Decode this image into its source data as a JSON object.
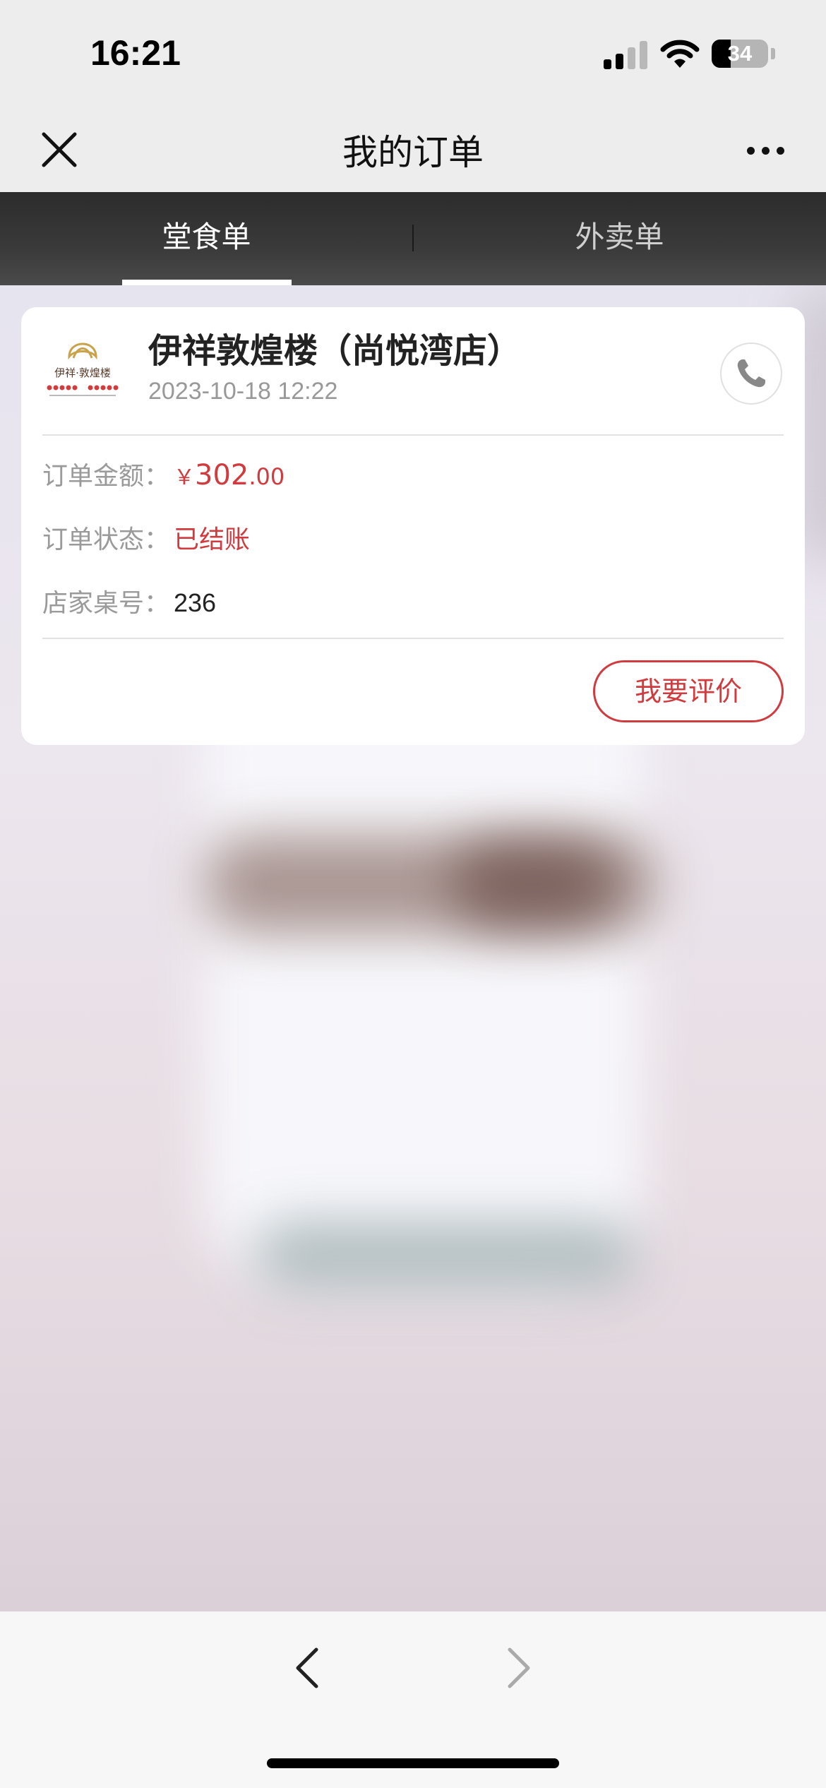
{
  "status_bar": {
    "time": "16:21",
    "battery_percent": "34",
    "battery_level": 0.34,
    "signal_bars_active": 2
  },
  "navbar": {
    "title": "我的订单",
    "close_icon": "close-icon",
    "more_icon": "more-icon"
  },
  "tabs": [
    {
      "label": "堂食单",
      "active": true
    },
    {
      "label": "外卖单",
      "active": false
    }
  ],
  "order": {
    "logo_text": "伊祥·敦煌楼",
    "store_name": "伊祥敦煌楼（尚悦湾店）",
    "time": "2023-10-18 12:22",
    "phone_icon": "phone-icon",
    "amount_label": "订单金额：",
    "amount_currency": "￥",
    "amount_integer": "302",
    "amount_decimal": ".00",
    "status_label": "订单状态：",
    "status_value": "已结账",
    "table_label": "店家桌号：",
    "table_value": "236",
    "review_button": "我要评价"
  },
  "bottom_bar": {
    "back_icon": "chevron-left-icon",
    "forward_icon": "chevron-right-icon"
  },
  "colors": {
    "accent": "#cf3b3e",
    "tab_bar": "#333333",
    "nav_background": "#ededed"
  }
}
